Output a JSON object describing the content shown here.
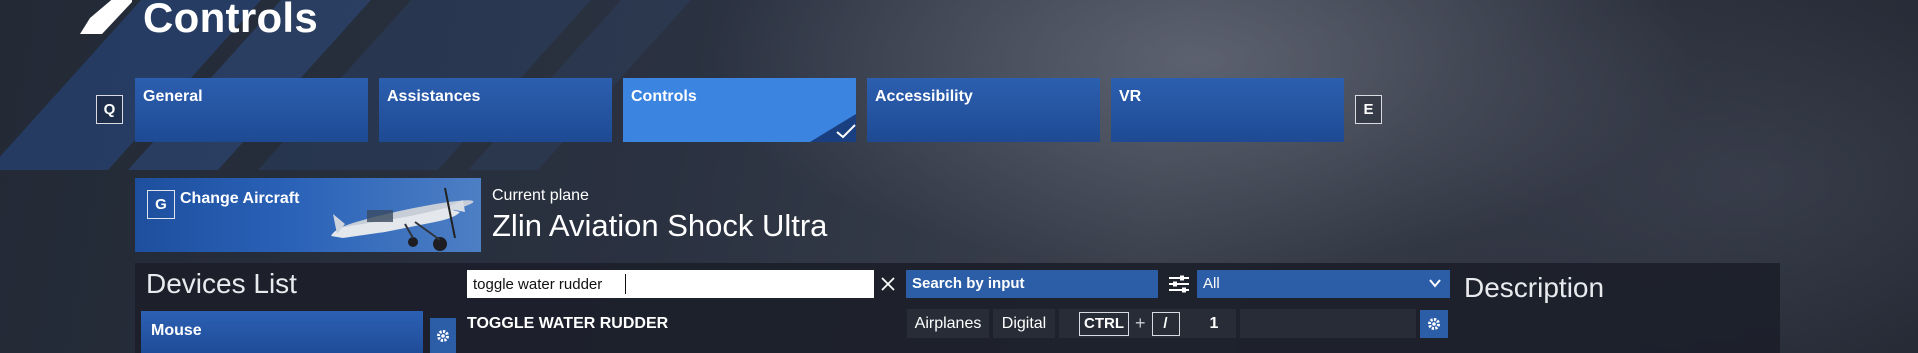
{
  "header": {
    "title": "Controls",
    "logo_icon": "slash-logo-icon"
  },
  "tabs": {
    "prev_key": "Q",
    "next_key": "E",
    "items": [
      {
        "label": "General"
      },
      {
        "label": "Assistances"
      },
      {
        "label": "Controls",
        "active": true
      },
      {
        "label": "Accessibility"
      },
      {
        "label": "VR"
      }
    ]
  },
  "aircraft": {
    "change_key": "G",
    "change_label": "Change Aircraft",
    "current_label": "Current plane",
    "current_name": "Zlin Aviation Shock Ultra"
  },
  "devices": {
    "title": "Devices List",
    "items": [
      {
        "label": "Mouse"
      }
    ]
  },
  "search": {
    "value": "toggle water rudder",
    "search_by_input_label": "Search by input",
    "category_selected": "All"
  },
  "bindings": [
    {
      "name": "TOGGLE WATER RUDDER",
      "category": "Airplanes",
      "type": "Digital",
      "keys": [
        "CTRL",
        "/"
      ],
      "count": "1"
    }
  ],
  "description": {
    "title": "Description"
  },
  "colors": {
    "accent": "#2c5ea8",
    "active_tab": "#3b84e0",
    "panel": "#1c202a"
  }
}
